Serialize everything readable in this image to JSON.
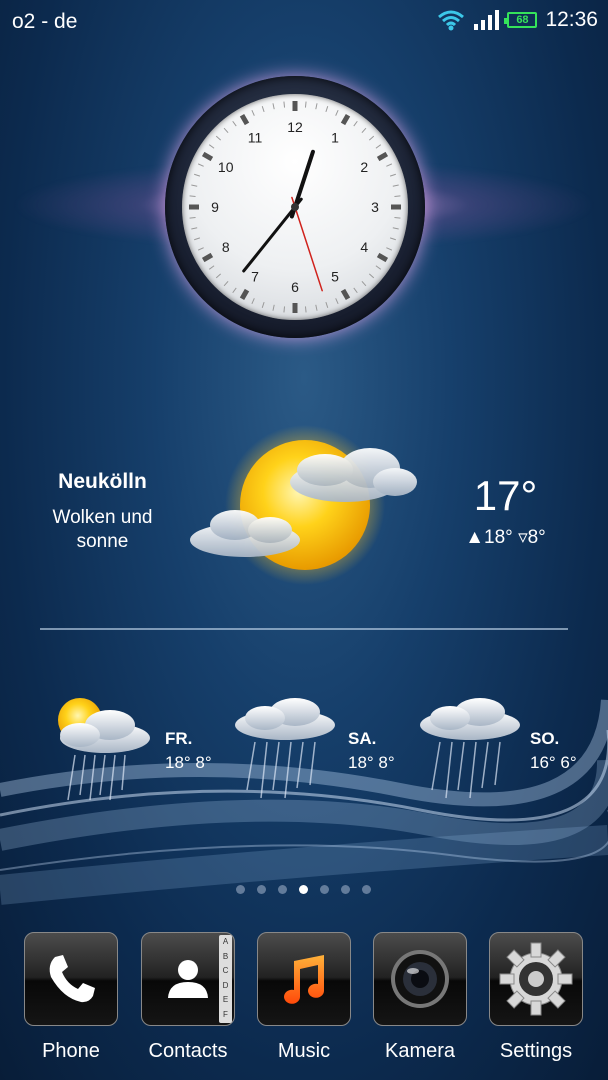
{
  "status_bar": {
    "carrier": "o2 - de",
    "battery_level": "68",
    "time": "12:36",
    "wifi_icon": "wifi-icon",
    "signal_icon": "signal-icon",
    "accent_color": "#35e35a"
  },
  "clock": {
    "numerals": [
      "12",
      "1",
      "2",
      "3",
      "4",
      "5",
      "6",
      "7",
      "8",
      "9",
      "10",
      "11"
    ],
    "hour": 12,
    "minute": 36,
    "second": 27
  },
  "weather": {
    "city": "Neukölln",
    "condition_line1": "Wolken und",
    "condition_line2": "sonne",
    "temp": "17°",
    "high": "▲18°",
    "low": "▿8°",
    "icon": "partly-cloudy-icon",
    "forecast": [
      {
        "day": "FR.",
        "temps": "18° 8°",
        "icon": "sun-rain-icon"
      },
      {
        "day": "SA.",
        "temps": "18° 8°",
        "icon": "rain-icon"
      },
      {
        "day": "SO.",
        "temps": "16° 6°",
        "icon": "rain-icon"
      }
    ]
  },
  "pager": {
    "count": 7,
    "active": 3
  },
  "dock": {
    "apps": [
      {
        "label": "Phone",
        "icon": "phone-icon"
      },
      {
        "label": "Contacts",
        "icon": "contacts-icon",
        "index_letters": [
          "A",
          "B",
          "C",
          "D",
          "E",
          "F"
        ]
      },
      {
        "label": "Music",
        "icon": "music-note-icon"
      },
      {
        "label": "Kamera",
        "icon": "camera-lens-icon"
      },
      {
        "label": "Settings",
        "icon": "gear-icon"
      }
    ]
  }
}
